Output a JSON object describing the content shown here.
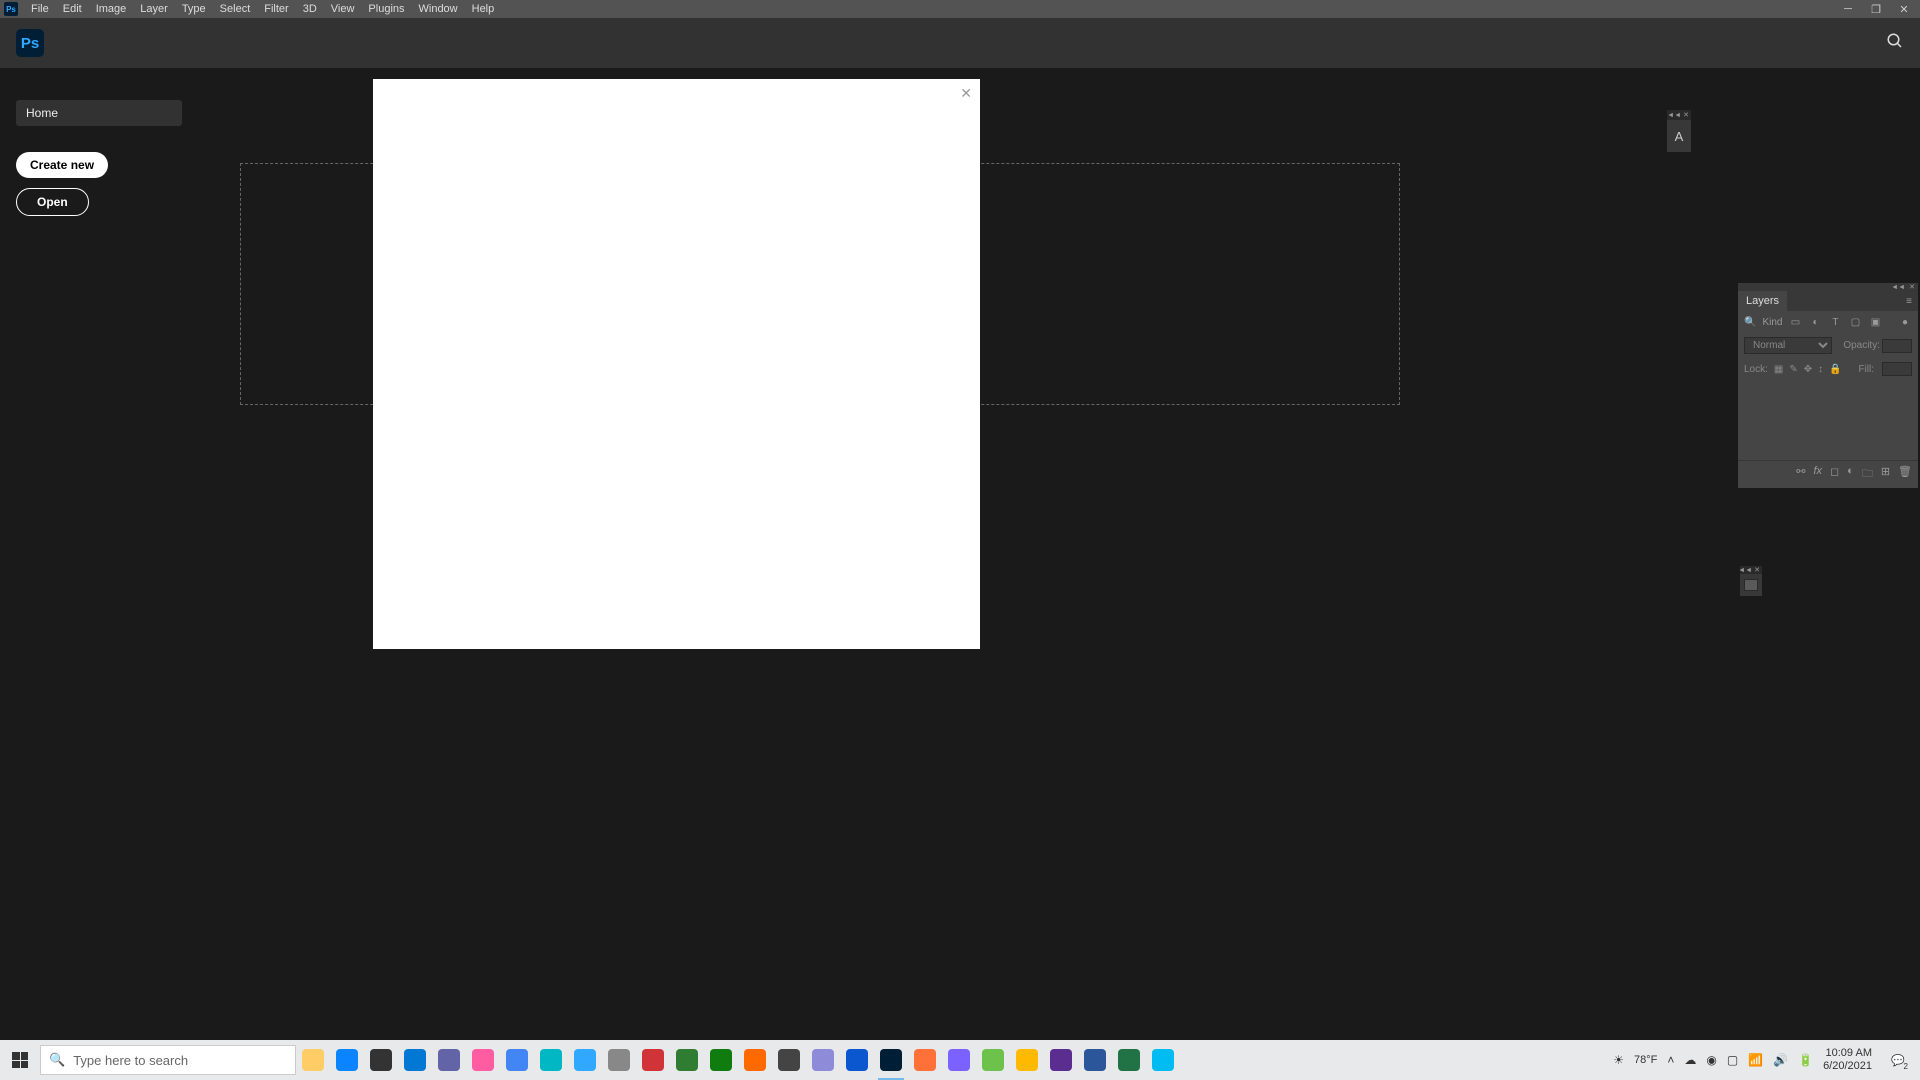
{
  "menubar": {
    "items": [
      "File",
      "Edit",
      "Image",
      "Layer",
      "Type",
      "Select",
      "Filter",
      "3D",
      "View",
      "Plugins",
      "Window",
      "Help"
    ]
  },
  "app": {
    "logo_text": "Ps"
  },
  "sidebar": {
    "home_label": "Home",
    "create_label": "Create new",
    "open_label": "Open"
  },
  "dialog": {
    "close": "✕"
  },
  "char_panel": {
    "text": "A"
  },
  "layers": {
    "title": "Layers",
    "kind_label": "Kind",
    "blend_mode": "Normal",
    "opacity_label": "Opacity:",
    "lock_label": "Lock:",
    "fill_label": "Fill:"
  },
  "taskbar": {
    "search_placeholder": "Type here to search",
    "weather": "78°F",
    "time": "10:09 AM",
    "date": "6/20/2021",
    "notif_count": "2"
  },
  "app_colors": [
    "#ffcc66",
    "#0a84ff",
    "#333",
    "#0078d4",
    "#6264a7",
    "#ff5ca1",
    "#4285f4",
    "#00b7c3",
    "#31a8ff",
    "#888",
    "#d13438",
    "#2e7d32",
    "#107c10",
    "#ff6a00",
    "#444",
    "#8e8cd8",
    "#0b57d0",
    "#001e36",
    "#ff7139",
    "#7b61ff",
    "#6cc24a",
    "#ffb900",
    "#5c2d91",
    "#2b579a",
    "#217346",
    "#00bcf2"
  ]
}
